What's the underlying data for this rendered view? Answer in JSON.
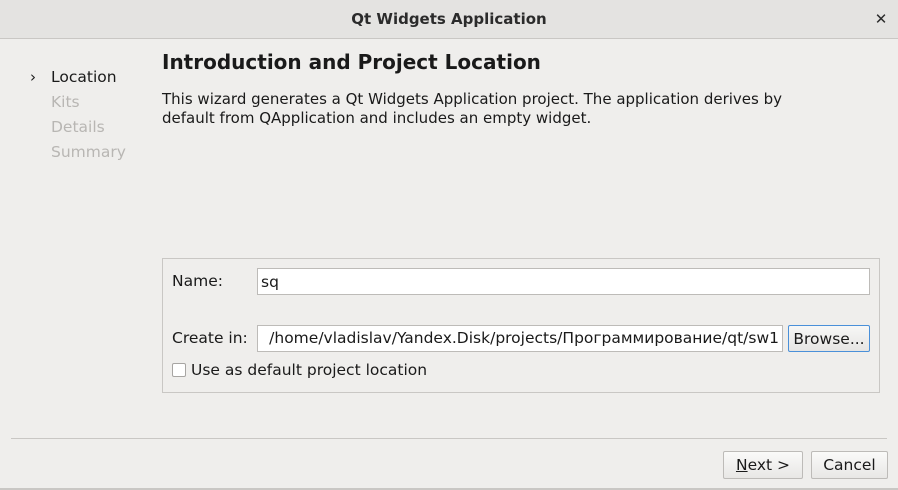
{
  "window": {
    "title": "Qt Widgets Application"
  },
  "steps": [
    {
      "label": "Location",
      "state": "current"
    },
    {
      "label": "Kits",
      "state": "pending"
    },
    {
      "label": "Details",
      "state": "pending"
    },
    {
      "label": "Summary",
      "state": "pending"
    }
  ],
  "page": {
    "heading": "Introduction and Project Location",
    "intro_line1": "This wizard generates a Qt Widgets Application project. The application derives by",
    "intro_line2": "default from QApplication and includes an empty widget."
  },
  "form": {
    "name_label": "Name:",
    "name_value": "sq",
    "create_in_label": "Create in:",
    "create_in_value": "/home/vladislav/Yandex.Disk/projects/Программирование/qt/sw1",
    "browse_label": "Browse...",
    "default_location_label": "Use as default project location",
    "default_location_checked": false
  },
  "buttons": {
    "next_mnemonic": "N",
    "next_rest": "ext >",
    "cancel_label": "Cancel"
  },
  "icons": {
    "close": "close-icon",
    "current_step": "chevron-right-icon"
  }
}
